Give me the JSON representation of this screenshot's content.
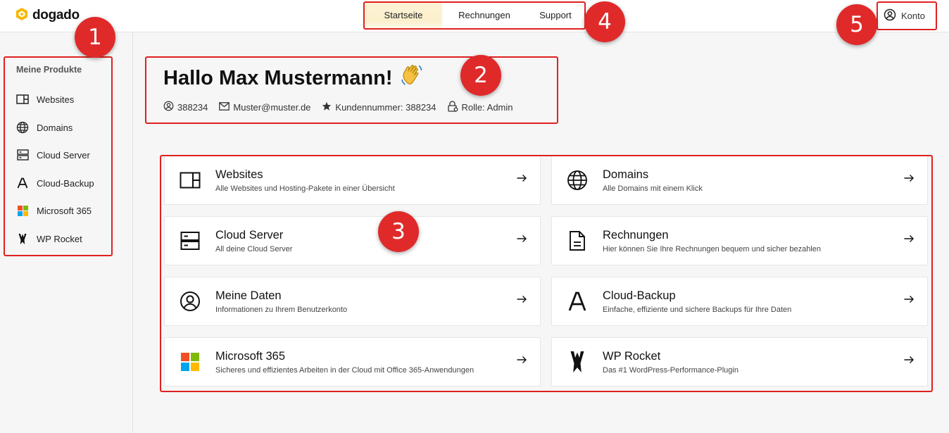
{
  "brand": {
    "name": "dogado",
    "accent": "#f5b800"
  },
  "topnav": {
    "items": [
      "Startseite",
      "Rechnungen",
      "Support"
    ],
    "active": "Startseite"
  },
  "account": {
    "label": "Konto",
    "icon": "user-circle-icon"
  },
  "sidebar": {
    "title": "Meine Produkte",
    "items": [
      {
        "label": "Websites",
        "icon": "website-icon"
      },
      {
        "label": "Domains",
        "icon": "globe-icon"
      },
      {
        "label": "Cloud Server",
        "icon": "server-icon"
      },
      {
        "label": "Cloud-Backup",
        "icon": "cloud-backup-icon"
      },
      {
        "label": "Microsoft 365",
        "icon": "microsoft-icon"
      },
      {
        "label": "WP Rocket",
        "icon": "wp-rocket-icon"
      }
    ]
  },
  "greeting": {
    "title": "Hallo Max Mustermann!",
    "emoji": "👋",
    "user_id": "388234",
    "email": "Muster@muster.de",
    "customer_number": "Kundennummer: 388234",
    "role": "Rolle: Admin"
  },
  "cards": [
    {
      "title": "Websites",
      "description": "Alle Websites und Hosting-Pakete in einer Übersicht",
      "icon": "website-icon"
    },
    {
      "title": "Domains",
      "description": "Alle Domains mit einem Klick",
      "icon": "globe-icon"
    },
    {
      "title": "Cloud Server",
      "description": "All deine Cloud Server",
      "icon": "server-icon"
    },
    {
      "title": "Rechnungen",
      "description": "Hier können Sie Ihre Rechnungen bequem und sicher bezahlen",
      "icon": "invoice-icon"
    },
    {
      "title": "Meine Daten",
      "description": "Informationen zu Ihrem Benutzerkonto",
      "icon": "user-circle-icon"
    },
    {
      "title": "Cloud-Backup",
      "description": "Einfache, effiziente und sichere Backups für Ihre Daten",
      "icon": "cloud-backup-icon"
    },
    {
      "title": "Microsoft 365",
      "description": "Sicheres und effizientes Arbeiten in der Cloud mit Office 365-Anwendungen",
      "icon": "microsoft-icon"
    },
    {
      "title": "WP Rocket",
      "description": "Das #1 WordPress-Performance-Plugin",
      "icon": "wp-rocket-icon"
    }
  ],
  "annotations": [
    "1",
    "2",
    "3",
    "4",
    "5"
  ],
  "colors": {
    "annotation_red": "#e02020",
    "active_tab_bg": "#fbefcc"
  }
}
